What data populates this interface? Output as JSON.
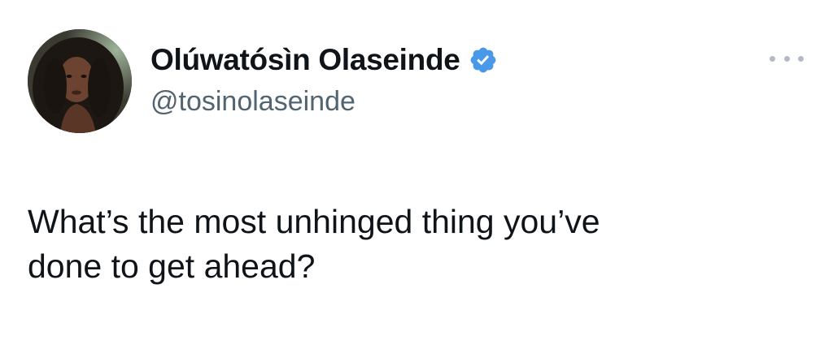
{
  "tweet": {
    "author": {
      "display_name": "Olúwatósìn Olaseinde",
      "handle": "@tosinolaseinde",
      "verified": true,
      "verified_color": "#4a99e9"
    },
    "more_icon": "more-horizontal-icon",
    "text": "What’s the most unhinged thing you’ve\ndone to get ahead?"
  },
  "colors": {
    "text_primary": "#0f1419",
    "text_secondary": "#536471",
    "background": "#ffffff"
  }
}
